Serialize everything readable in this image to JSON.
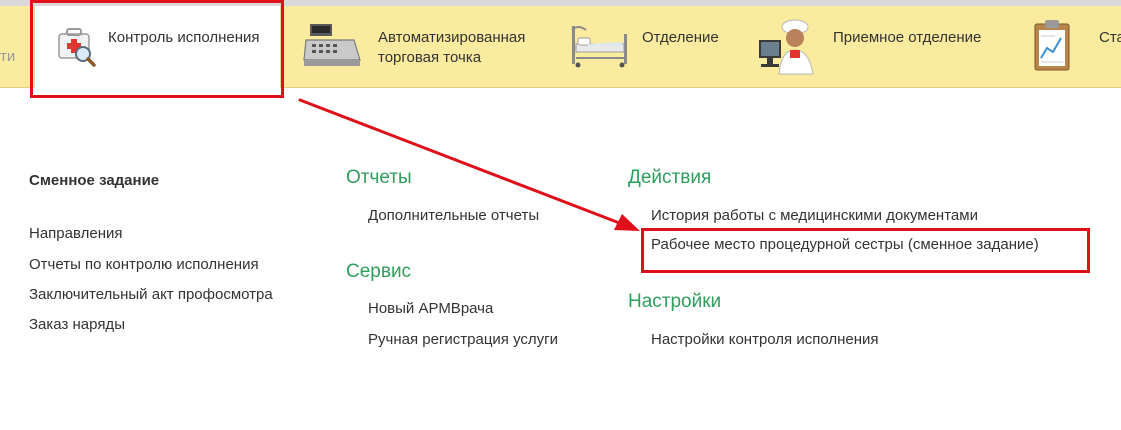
{
  "topbar": {
    "prev_partial_label": "ти",
    "sections": [
      {
        "label": "Контроль исполнения",
        "icon": "first-aid-kit-magnifier-icon",
        "active": true
      },
      {
        "label_line1": "Автоматизированная",
        "label_line2": "торговая точка",
        "icon": "cash-register-icon",
        "active": false
      },
      {
        "label": "Отделение",
        "icon": "hospital-bed-icon",
        "active": false
      },
      {
        "label": "Приемное отделение",
        "icon": "doctor-at-computer-icon",
        "active": false
      },
      {
        "label": "Ста",
        "icon": "clipboard-chart-icon",
        "active": false
      }
    ]
  },
  "left_column": {
    "title": "Сменное задание",
    "items": [
      "Направления",
      "Отчеты по контролю исполнения",
      "Заключительный акт профосмотра",
      "Заказ наряды"
    ]
  },
  "middle_column": {
    "groups": [
      {
        "title": "Отчеты",
        "items": [
          "Дополнительные отчеты"
        ]
      },
      {
        "title": "Сервис",
        "items": [
          "Новый АРМВрача",
          "Ручная регистрация услуги"
        ]
      }
    ]
  },
  "right_column": {
    "groups": [
      {
        "title": "Действия",
        "items": [
          "История работы с медицинскими документами",
          "Рабочее место процедурной сестры (сменное задание)"
        ]
      },
      {
        "title": "Настройки",
        "items": [
          "Настройки контроля исполнения"
        ]
      }
    ]
  },
  "colors": {
    "topbar_bg": "#fbeb9f",
    "group_title": "#2e9e5b",
    "annotation_red": "#e0101a"
  }
}
